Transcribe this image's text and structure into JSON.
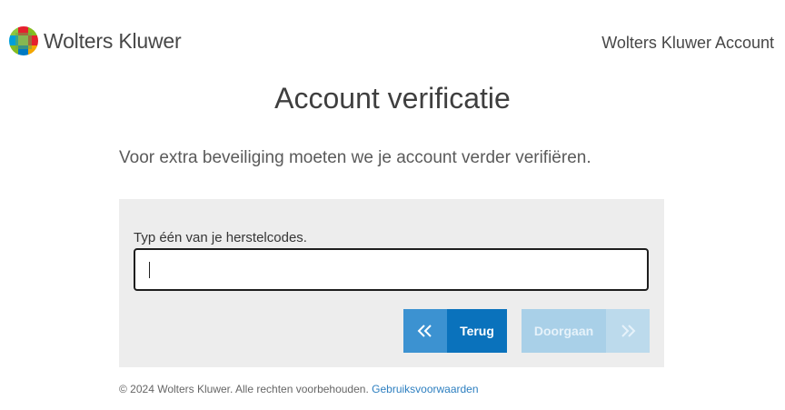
{
  "header": {
    "brand_name": "Wolters Kluwer",
    "account_link": "Wolters Kluwer Account"
  },
  "main": {
    "title": "Account verificatie",
    "subtitle": "Voor extra beveiliging moeten we je account verder verifiëren.",
    "field_label": "Typ één van je herstelcodes.",
    "field_value": "",
    "back_button": "Terug",
    "continue_button": "Doorgaan"
  },
  "footer": {
    "copyright": "© 2024 Wolters Kluwer. Alle rechten voorbehouden.",
    "terms_link": "Gebruiksvoorwaarden"
  },
  "icons": {
    "back": "double-chevron-left-icon",
    "continue": "double-chevron-right-icon"
  },
  "colors": {
    "primary": "#0a72bc",
    "primary_light": "#3c92d1",
    "disabled": "#a9d0e8",
    "panel_bg": "#ededed",
    "link": "#2d7fc0"
  }
}
